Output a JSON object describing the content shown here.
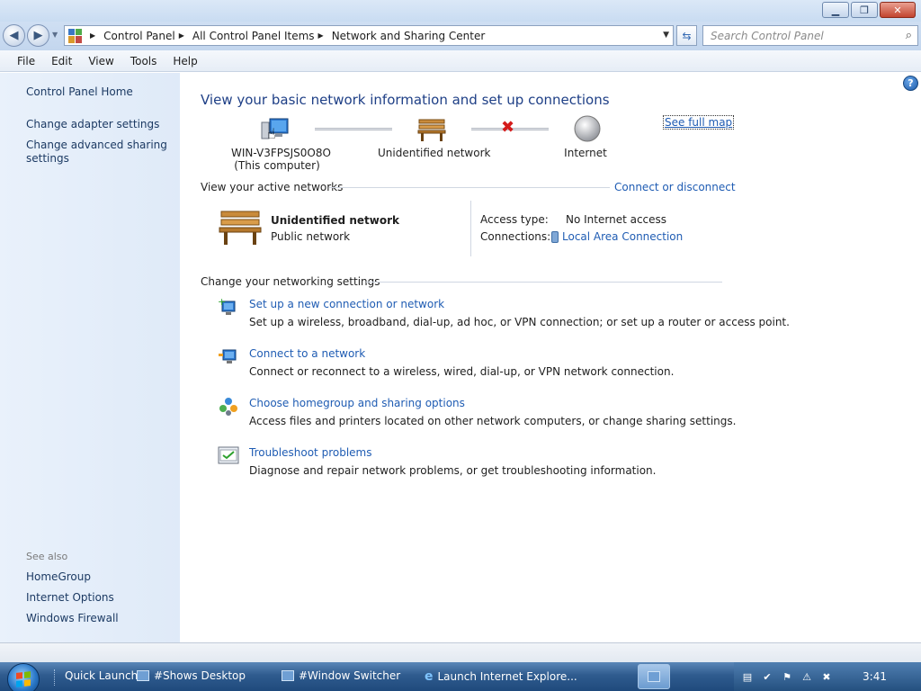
{
  "window": {
    "minimize": "▁",
    "maximize": "❐",
    "close": "✕"
  },
  "address": {
    "breadcrumbs": [
      "Control Panel",
      "All Control Panel Items",
      "Network and Sharing Center"
    ],
    "search_placeholder": "Search Control Panel"
  },
  "menu": {
    "items": [
      {
        "label": "File",
        "accel": "F"
      },
      {
        "label": "Edit",
        "accel": "E"
      },
      {
        "label": "View",
        "accel": "V"
      },
      {
        "label": "Tools",
        "accel": "T"
      },
      {
        "label": "Help",
        "accel": "H"
      }
    ]
  },
  "sidebar": {
    "home": "Control Panel Home",
    "links": [
      "Change adapter settings",
      "Change advanced sharing settings"
    ],
    "see_also_title": "See also",
    "see_also": [
      "HomeGroup",
      "Internet Options",
      "Windows Firewall"
    ]
  },
  "main": {
    "heading": "View your basic network information and set up connections",
    "see_full_map": "See full map",
    "map": {
      "computer_name": "WIN-V3FPSJS0O8O",
      "computer_sub": "(This computer)",
      "network": "Unidentified network",
      "internet": "Internet"
    },
    "active": {
      "title": "View your active networks",
      "connect_link": "Connect or disconnect",
      "network_name": "Unidentified network",
      "network_type": "Public network",
      "access_label": "Access type:",
      "access_value": "No Internet access",
      "connections_label": "Connections:",
      "connections_value": "Local Area Connection"
    },
    "settings": {
      "title": "Change your networking settings",
      "tasks": [
        {
          "title": "Set up a new connection or network",
          "desc": "Set up a wireless, broadband, dial-up, ad hoc, or VPN connection; or set up a router or access point.",
          "icon": "new-connection-icon"
        },
        {
          "title": "Connect to a network",
          "desc": "Connect or reconnect to a wireless, wired, dial-up, or VPN network connection.",
          "icon": "connect-network-icon"
        },
        {
          "title": "Choose homegroup and sharing options",
          "desc": "Access files and printers located on other network computers, or change sharing settings.",
          "icon": "homegroup-icon"
        },
        {
          "title": "Troubleshoot problems",
          "desc": "Diagnose and repair network problems, or get troubleshooting information.",
          "icon": "troubleshoot-icon"
        }
      ]
    }
  },
  "taskbar": {
    "items": [
      "Quick Launch",
      "#Shows Desktop",
      "#Window Switcher",
      "Launch Internet Explore..."
    ],
    "clock": "3:41"
  },
  "colors": {
    "link": "#1f5cb3",
    "heading": "#1e3f86",
    "sidebar_bg": "#e3edf9",
    "taskbar": "#2f5b8e"
  }
}
